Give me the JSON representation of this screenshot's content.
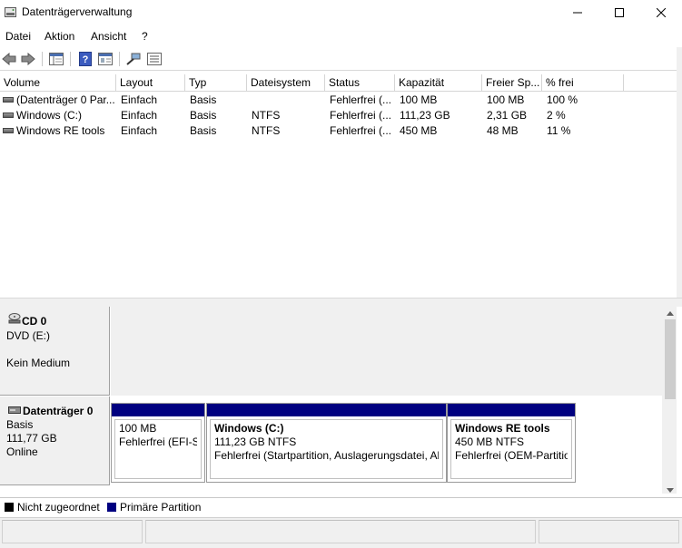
{
  "window": {
    "title": "Datenträgerverwaltung"
  },
  "menu": [
    "Datei",
    "Aktion",
    "Ansicht",
    "?"
  ],
  "columns": [
    "Volume",
    "Layout",
    "Typ",
    "Dateisystem",
    "Status",
    "Kapazität",
    "Freier Sp...",
    "% frei"
  ],
  "volumes": [
    {
      "volume": "(Datenträger 0 Par...",
      "layout": "Einfach",
      "typ": "Basis",
      "fs": "",
      "status": "Fehlerfrei (...",
      "kapazitaet": "100 MB",
      "frei": "100 MB",
      "pfrei": "100 %"
    },
    {
      "volume": "Windows (C:)",
      "layout": "Einfach",
      "typ": "Basis",
      "fs": "NTFS",
      "status": "Fehlerfrei (...",
      "kapazitaet": "111,23 GB",
      "frei": "2,31 GB",
      "pfrei": "2 %"
    },
    {
      "volume": "Windows RE tools",
      "layout": "Einfach",
      "typ": "Basis",
      "fs": "NTFS",
      "status": "Fehlerfrei (...",
      "kapazitaet": "450 MB",
      "frei": "48 MB",
      "pfrei": "11 %"
    }
  ],
  "disks": [
    {
      "name": "CD 0",
      "line2": "DVD (E:)",
      "line3": "",
      "line4": "Kein Medium"
    },
    {
      "name": "Datenträger 0",
      "line2": "Basis",
      "line3": "111,77 GB",
      "line4": "Online"
    }
  ],
  "partitions": [
    {
      "title": "",
      "size": "100 MB",
      "status": "Fehlerfrei (EFI-Sy"
    },
    {
      "title": "Windows  (C:)",
      "size": "111,23 GB NTFS",
      "status": "Fehlerfrei (Startpartition, Auslagerungsdatei, Ab"
    },
    {
      "title": "Windows RE tools",
      "size": "450 MB NTFS",
      "status": "Fehlerfrei (OEM-Partitio"
    }
  ],
  "legend": [
    {
      "label": "Nicht zugeordnet",
      "color": "#000000"
    },
    {
      "label": "Primäre Partition",
      "color": "#000080"
    }
  ],
  "icons": {
    "toolbar": [
      "back-icon",
      "forward-icon",
      "console-tree-icon",
      "help-icon",
      "properties-icon",
      "connect-icon",
      "list-icon"
    ]
  }
}
